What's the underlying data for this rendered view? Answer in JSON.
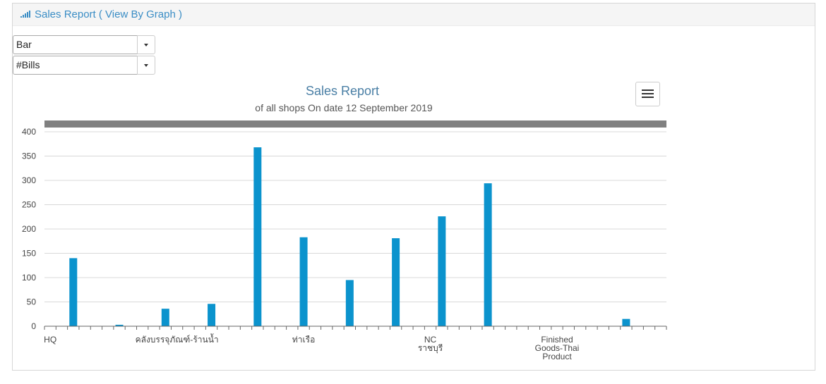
{
  "panel": {
    "title": "Sales Report ( View By Graph )",
    "icon": "signal-bars-icon",
    "accent": "#3a8dc5"
  },
  "controls": {
    "chart_type": "Bar",
    "metric": "#Bills"
  },
  "chart_data": {
    "type": "bar",
    "title": "Sales Report",
    "subtitle": "of all shops  On date 12 September 2019",
    "xlabel": "",
    "ylabel": "",
    "ylim": [
      0,
      400
    ],
    "yticks": [
      0,
      50,
      100,
      150,
      200,
      250,
      300,
      350,
      400
    ],
    "grid": true,
    "legend": "none",
    "bar_color": "#0b93cd",
    "category_count": 54,
    "bars": [
      {
        "index": 2,
        "value": 140
      },
      {
        "index": 6,
        "value": 3
      },
      {
        "index": 10,
        "value": 36
      },
      {
        "index": 14,
        "value": 46
      },
      {
        "index": 18,
        "value": 368
      },
      {
        "index": 22,
        "value": 183
      },
      {
        "index": 26,
        "value": 95
      },
      {
        "index": 30,
        "value": 181
      },
      {
        "index": 34,
        "value": 226
      },
      {
        "index": 38,
        "value": 294
      },
      {
        "index": 50,
        "value": 15
      }
    ],
    "x_labels": [
      {
        "index": 0,
        "lines": [
          "HQ"
        ]
      },
      {
        "index": 11,
        "lines": [
          "คลังบรรจุภัณฑ์-ร้านน้ำ"
        ]
      },
      {
        "index": 22,
        "lines": [
          "ท่าเรือ"
        ]
      },
      {
        "index": 33,
        "lines": [
          "NC",
          "ราชบุรี"
        ]
      },
      {
        "index": 44,
        "lines": [
          "Finished",
          "Goods-Thai",
          "Product"
        ]
      }
    ]
  }
}
